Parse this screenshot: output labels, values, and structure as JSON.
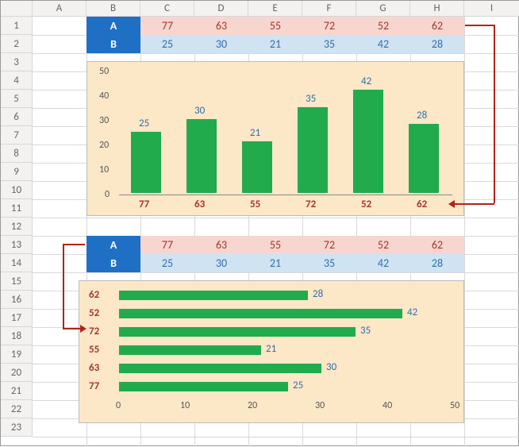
{
  "columns": [
    "A",
    "B",
    "C",
    "D",
    "E",
    "F",
    "G",
    "H",
    "I"
  ],
  "rows_visible": 23,
  "top_table": {
    "headerA": "A",
    "headerB": "B",
    "rowA": [
      77,
      63,
      55,
      72,
      52,
      62
    ],
    "rowB": [
      25,
      30,
      21,
      35,
      42,
      28
    ]
  },
  "bottom_table": {
    "headerA": "A",
    "headerB": "B",
    "rowA": [
      77,
      63,
      55,
      72,
      52,
      62
    ],
    "rowB": [
      25,
      30,
      21,
      35,
      42,
      28
    ]
  },
  "chart_data": [
    {
      "type": "bar",
      "orientation": "vertical",
      "categories": [
        77,
        63,
        55,
        72,
        52,
        62
      ],
      "values": [
        25,
        30,
        21,
        35,
        42,
        28
      ],
      "ylim": [
        0,
        50
      ],
      "yticks": [
        0,
        10,
        20,
        30,
        40,
        50
      ],
      "data_labels": true,
      "bar_color": "#21ab4c",
      "plot_bg": "#fce7c7"
    },
    {
      "type": "bar",
      "orientation": "horizontal",
      "categories": [
        62,
        52,
        72,
        55,
        63,
        77
      ],
      "values": [
        28,
        42,
        35,
        21,
        30,
        25
      ],
      "xlim": [
        0,
        50
      ],
      "xticks": [
        0,
        10,
        20,
        30,
        40,
        50
      ],
      "data_labels": true,
      "bar_color": "#21ab4c",
      "plot_bg": "#fce7c7"
    }
  ]
}
